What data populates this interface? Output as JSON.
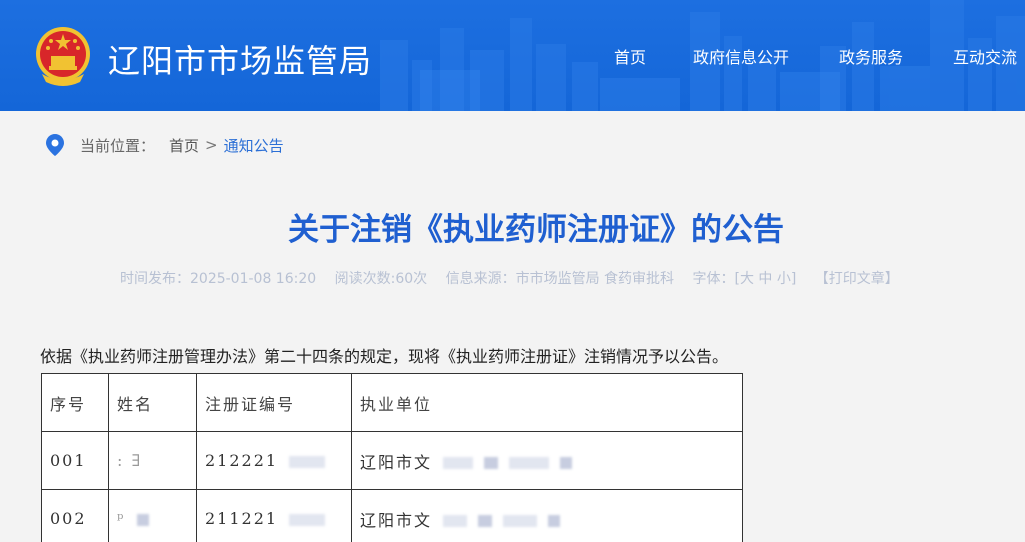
{
  "header": {
    "site_title": "辽阳市市场监管局",
    "nav": [
      {
        "label": "首页"
      },
      {
        "label": "政府信息公开"
      },
      {
        "label": "政务服务"
      },
      {
        "label": "互动交流"
      }
    ]
  },
  "breadcrumb": {
    "label": "当前位置：",
    "home": "首页",
    "separator": ">",
    "current": "通知公告"
  },
  "article": {
    "title": "关于注销《执业药师注册证》的公告",
    "meta": {
      "publish_time": "时间发布：2025-01-08 16:20",
      "read_count": "阅读次数:60次",
      "source": "信息来源：市市场监管局 食药审批科",
      "font_size": "字体：[大 中 小]",
      "print": "【打印文章】"
    },
    "intro": "依据《执业药师注册管理办法》第二十四条的规定，现将《执业药师注册证》注销情况予以公告。"
  },
  "table": {
    "headers": [
      "序号",
      "姓名",
      "注册证编号",
      "执业单位"
    ],
    "rows": [
      {
        "no": "001",
        "name": ":   ∃",
        "cert": "212221",
        "unit": "辽阳市文"
      },
      {
        "no": "002",
        "name": "ᵖ",
        "cert": "211221",
        "unit": "辽阳市文"
      }
    ]
  },
  "colors": {
    "header_blue": "#1466d8",
    "title_blue": "#1f5fd0",
    "meta_gray": "#b8c1d3",
    "page_bg": "#f3f3f3"
  },
  "icons": {
    "emblem": "national-emblem-icon",
    "location": "location-pin-icon"
  }
}
